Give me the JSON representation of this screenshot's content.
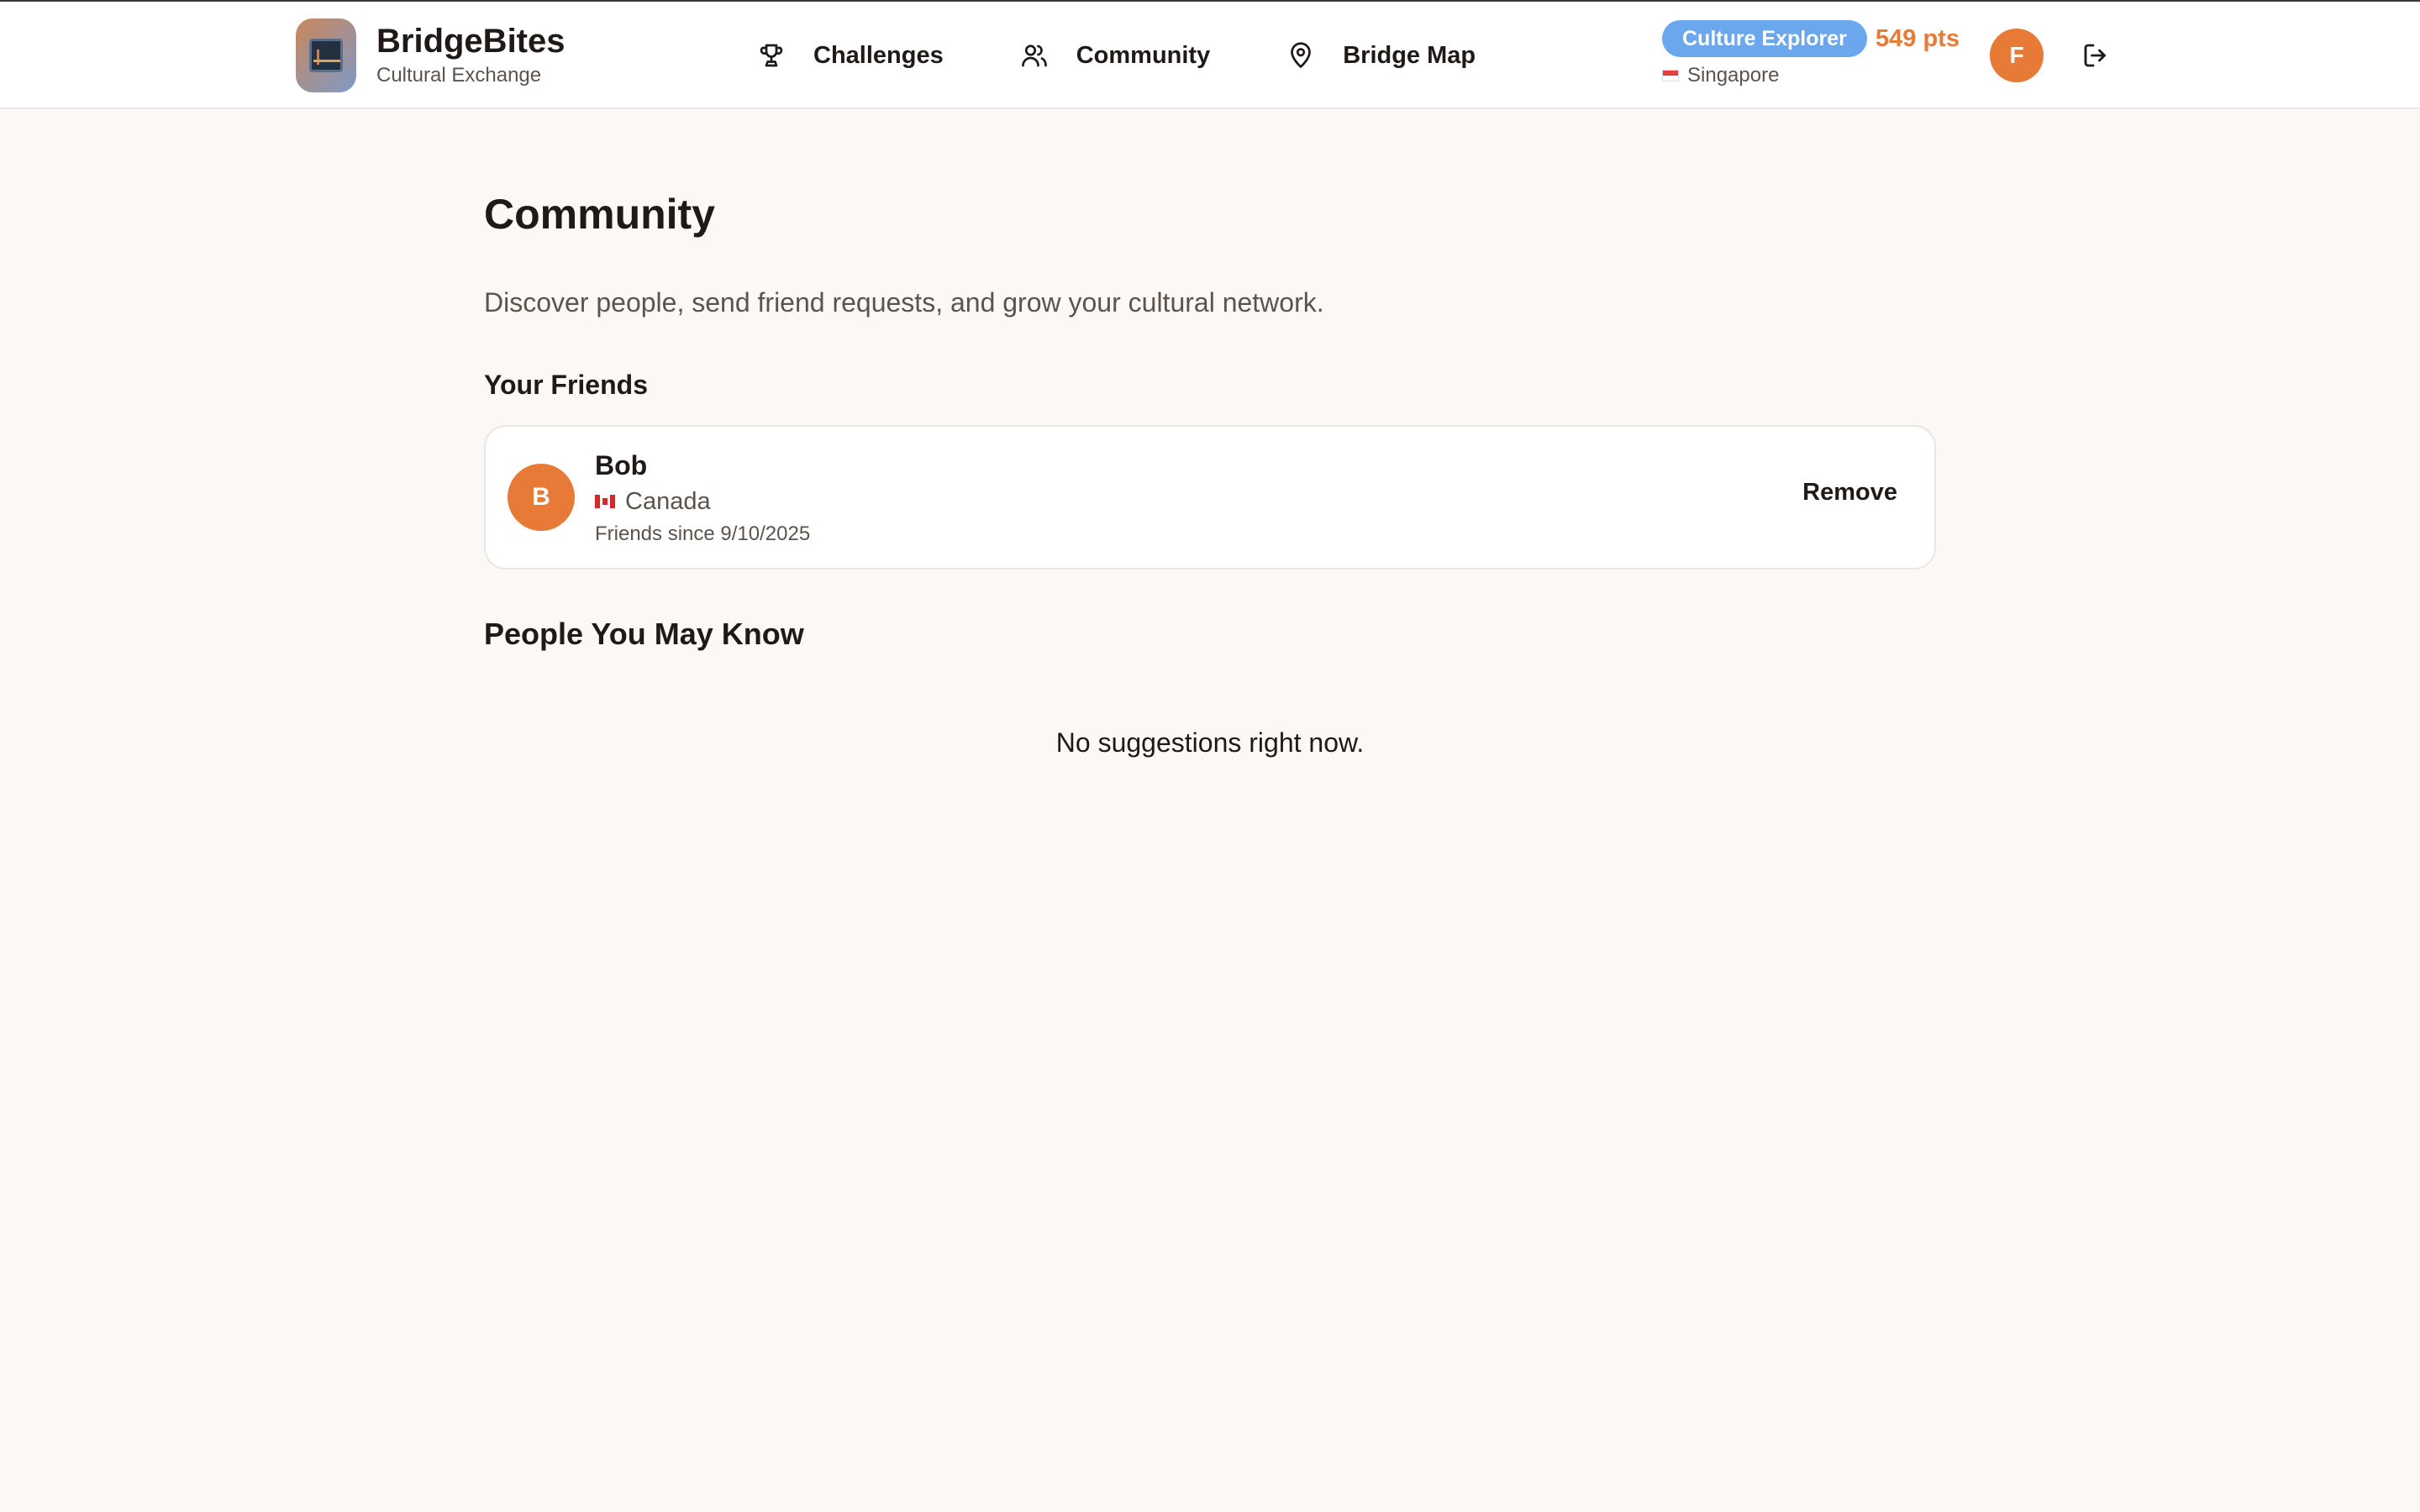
{
  "app": {
    "name": "BridgeBites",
    "subtitle": "Cultural Exchange"
  },
  "nav": [
    {
      "label": "Challenges",
      "icon": "trophy-icon"
    },
    {
      "label": "Community",
      "icon": "users-icon"
    },
    {
      "label": "Bridge Map",
      "icon": "map-pin-icon"
    }
  ],
  "user": {
    "badge": "Culture Explorer",
    "points": "549 pts",
    "country": "Singapore",
    "initial": "F"
  },
  "page": {
    "title": "Community",
    "description": "Discover people, send friend requests, and grow your cultural network."
  },
  "friends": {
    "section_title": "Your Friends",
    "items": [
      {
        "initial": "B",
        "name": "Bob",
        "country": "Canada",
        "since": "Friends since 9/10/2025",
        "action": "Remove"
      }
    ]
  },
  "suggestions": {
    "section_title": "People You May Know",
    "empty_message": "No suggestions right now."
  },
  "colors": {
    "accent": "#e77a36",
    "badge": "#6aa7ec",
    "background": "#fcf8f5"
  }
}
